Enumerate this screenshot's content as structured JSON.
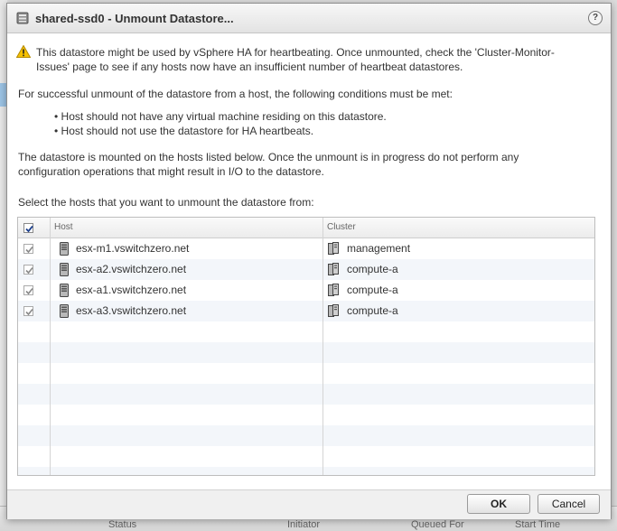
{
  "dialog": {
    "title": "shared-ssd0 - Unmount Datastore...",
    "help_label": "?"
  },
  "content": {
    "warning": "This datastore might be used by vSphere HA for heartbeating. Once unmounted, check the 'Cluster-Monitor-Issues' page to see if any hosts now have an insufficient number of heartbeat datastores.",
    "conditions_intro": "For successful unmount of the datastore from a host, the following conditions must be met:",
    "conditions": [
      "Host should not have any virtual machine residing on this datastore.",
      "Host should not use the datastore for HA heartbeats."
    ],
    "mounted_note": "The datastore is mounted on the hosts listed below. Once the unmount is in progress do not perform any configuration operations that might result in I/O to the datastore.",
    "select_prompt": "Select the hosts that you want to unmount the datastore from:"
  },
  "table": {
    "columns": [
      "Host",
      "Cluster"
    ],
    "select_all_checked": true,
    "rows": [
      {
        "host": "esx-m1.vswitchzero.net",
        "cluster": "management",
        "checked": true
      },
      {
        "host": "esx-a2.vswitchzero.net",
        "cluster": "compute-a",
        "checked": true
      },
      {
        "host": "esx-a1.vswitchzero.net",
        "cluster": "compute-a",
        "checked": true
      },
      {
        "host": "esx-a3.vswitchzero.net",
        "cluster": "compute-a",
        "checked": true
      }
    ]
  },
  "buttons": {
    "ok": "OK",
    "cancel": "Cancel"
  },
  "background": {
    "columns": [
      "Status",
      "Initiator",
      "Queued For",
      "Start Time"
    ]
  },
  "icons": {
    "title": "datastore-icon",
    "warning": "warning-icon",
    "host": "host-icon",
    "cluster": "cluster-icon"
  }
}
